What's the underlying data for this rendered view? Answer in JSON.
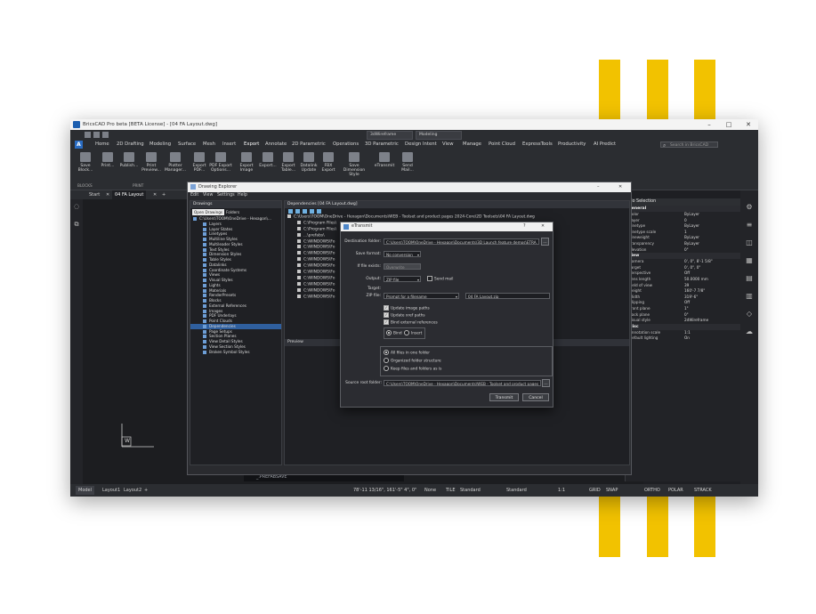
{
  "window": {
    "title": "BricsCAD Pro beta [BETA License] - [04 FA Layout.dwg]",
    "controls": {
      "minimize": "–",
      "maximize": "□",
      "close": "✕"
    }
  },
  "quick_access": {
    "workspace": "3dWireframe",
    "modeling": "Modeling"
  },
  "menu": {
    "logo": "A",
    "items": [
      "Home",
      "2D Drafting",
      "Modeling",
      "Surface",
      "Mesh",
      "Insert",
      "Export",
      "Annotate",
      "2D Parametric",
      "Operations",
      "3D Parametric",
      "Design Intent",
      "View",
      "Manage",
      "Point Cloud",
      "ExpressTools",
      "Productivity",
      "AI Predict"
    ],
    "active": "Export",
    "search_placeholder": "Search in BricsCAD"
  },
  "ribbon": {
    "buttons": [
      "Save Block...",
      "Print...",
      "Publish...",
      "Print Preview...",
      "Plotter Manager...",
      "Export PDF...",
      "PDF Export Options...",
      "Export Image",
      "Export...",
      "Export Table...",
      "Datalink Update",
      "FBX Export",
      "Save Dimension Style",
      "eTransmit",
      "Send Mail..."
    ],
    "groups": [
      "BLOCKS",
      "PRINT"
    ]
  },
  "doc_tabs": {
    "start": "Start",
    "active": "04 FA Layout",
    "close": "✕",
    "add": "+"
  },
  "drawing_explorer": {
    "title": "Drawing Explorer",
    "menu": [
      "Edit",
      "View",
      "Settings",
      "Help"
    ],
    "left_header": "Drawings",
    "subtabs": [
      "Open Drawings",
      "Folders"
    ],
    "root": "C:\\Users\\TOOM\\OneDrive - Hexagon\\...",
    "tree": [
      "Layers",
      "Layer States",
      "Linetypes",
      "Multiline Styles",
      "Multileader Styles",
      "Text Styles",
      "Dimension Styles",
      "Table Styles",
      "Datalinks",
      "Coordinate Systems",
      "Views",
      "Visual Styles",
      "Lights",
      "Materials",
      "RenderPresets",
      "Blocks",
      "External References",
      "Images",
      "PDF Underlays",
      "Point Clouds",
      "Dependencies",
      "Page Setups",
      "Section Planes",
      "View Detail Styles",
      "View Section Styles",
      "Broken Symbol Styles"
    ],
    "selected": "Dependencies",
    "right_header": "Dependencies [04 FA Layout.dwg]",
    "dep_root": "C:\\Users\\TOOM\\OneDrive - Hexagon\\Documents\\WEB - Toolset and product pages 2024-Core\\2D Toolsets\\04 FA Layout.dwg",
    "dep_items": [
      "C:\\Program Files\\",
      "C:\\Program Files\\",
      "...\\prefabs\\",
      "C:\\WINDOWS\\Fo",
      "C:\\WINDOWS\\Fo",
      "C:\\WINDOWS\\Fo",
      "C:\\WINDOWS\\Fo",
      "C:\\WINDOWS\\Fo",
      "C:\\WINDOWS\\Fo",
      "C:\\WINDOWS\\Fo",
      "C:\\WINDOWS\\Fo",
      "C:\\WINDOWS\\Fo",
      "C:\\WINDOWS\\Fo"
    ],
    "preview_label": "Preview"
  },
  "etransmit": {
    "title": "eTransmit",
    "help": "?",
    "close": "✕",
    "destination_label": "Destination folder:",
    "destination_value": "C:\\Users\\TOOM\\OneDrive - Hexagon\\Documents\\3D Launch feature demos\\ETRA",
    "browse": "...",
    "save_format_label": "Save format:",
    "save_format_value": "No conversion",
    "if_exists_label": "If file exists:",
    "if_exists_value": "Overwrite",
    "output_label": "Output:",
    "output_value": "ZIP file",
    "send_mail": "Send mail",
    "target_label": "Target:",
    "zip_label": "ZIP file:",
    "zip_mode": "Prompt for a filename",
    "zip_value": "04 FA Layout.zip",
    "update_image": "Update image paths",
    "update_xref": "Update xref paths",
    "bind_xrefs": "Bind external references",
    "bind_option": "Bind",
    "insert_option": "Insert",
    "folder_options": [
      "All files in one folder",
      "Organized folder structure",
      "Keep files and folders as is"
    ],
    "source_root_label": "Source root folder:",
    "source_root_value": "C:\\Users\\TOOM\\OneDrive - Hexagon\\Documents\\WEB - Toolset and product pages",
    "transmit": "Transmit",
    "cancel": "Cancel"
  },
  "properties": {
    "selection": "No Selection",
    "general_header": "General",
    "general": [
      {
        "k": "Color",
        "v": "ByLayer"
      },
      {
        "k": "Layer",
        "v": "0"
      },
      {
        "k": "Linetype",
        "v": "ByLayer"
      },
      {
        "k": "Linetype scale",
        "v": "1"
      },
      {
        "k": "Lineweight",
        "v": "ByLayer"
      },
      {
        "k": "Transparency",
        "v": "ByLayer"
      },
      {
        "k": "Elevation",
        "v": "0\""
      }
    ],
    "view_header": "View",
    "view": [
      {
        "k": "Camera",
        "v": "0', 0\", 8'-1 5/8\""
      },
      {
        "k": "Target",
        "v": "0', 0\", 0\""
      },
      {
        "k": "Perspective",
        "v": "Off"
      },
      {
        "k": "Lens length",
        "v": "50.0000 mm"
      },
      {
        "k": "Field of view",
        "v": "39"
      },
      {
        "k": "Height",
        "v": "160'-7 7/8\""
      },
      {
        "k": "Width",
        "v": "319'-6\""
      },
      {
        "k": "Clipping",
        "v": "Off"
      },
      {
        "k": "Front plane",
        "v": "1\""
      },
      {
        "k": "Back plane",
        "v": "0\""
      },
      {
        "k": "Visual style",
        "v": "2dWireframe"
      }
    ],
    "misc_header": "Misc",
    "misc": [
      {
        "k": "Annotation scale",
        "v": "1:1"
      },
      {
        "k": "Default lighting",
        "v": "On"
      }
    ]
  },
  "layout_tabs": [
    "Model",
    "Layout1",
    "Layout2",
    "+"
  ],
  "command_line": "_.PREFABSAVE",
  "ucs_label": "W",
  "status": {
    "coords": "78'-11 13/16\", 161'-5\" 4\", 0\"",
    "none": "None",
    "tile": "TILE",
    "standard1": "Standard",
    "standard2": "Standard",
    "scale": "1:1",
    "grid": "GRID",
    "snap": "SNAP",
    "ortho": "ORTHO",
    "polar": "POLAR",
    "strack": "STRACK"
  },
  "colors": {
    "accent": "#f2c200",
    "ui_dark": "#1e1f23",
    "select_blue": "#2f5f9e"
  }
}
